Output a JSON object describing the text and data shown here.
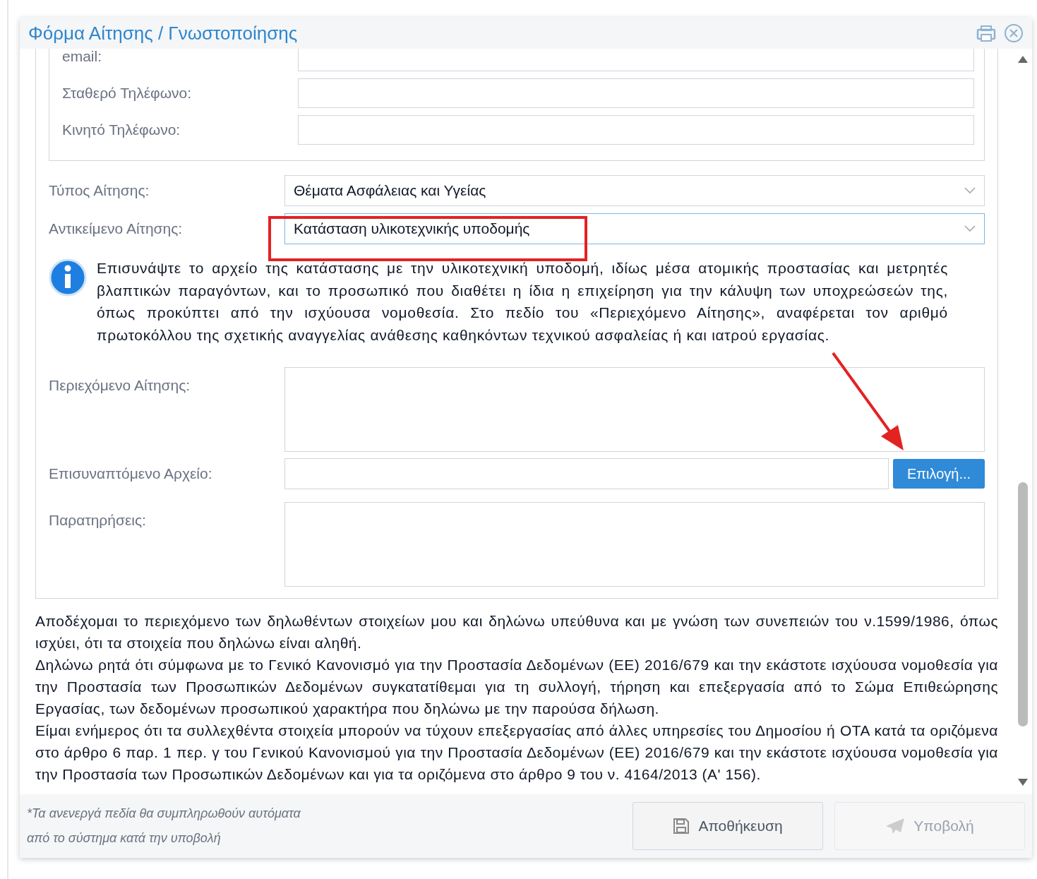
{
  "window": {
    "title": "Φόρμα Αίτησης / Γνωστοποίησης"
  },
  "contact_fields": [
    {
      "label": "email:"
    },
    {
      "label": "Σταθερό Τηλέφωνο:"
    },
    {
      "label": "Κινητό Τηλέφωνο:"
    }
  ],
  "selects": [
    {
      "label": "Τύπος Αίτησης:",
      "value": "Θέματα Ασφάλειας και Υγείας",
      "focused": false
    },
    {
      "label": "Αντικείμενο Αίτησης:",
      "value": "Κατάσταση υλικοτεχνικής υποδομής",
      "focused": true
    }
  ],
  "info": "Επισυνάψτε το αρχείο της κατάστασης με την υλικοτεχνική υποδομή, ιδίως μέσα ατομικής προστασίας και μετρητές βλαπτικών παραγόντων, και το προσωπικό που διαθέτει η ίδια η επιχείρηση για την κάλυψη των υποχρεώσεών της, όπως προκύπτει από την ισχύουσα νομοθεσία. Στο πεδίο του «Περιεχόμενο Αίτησης», αναφέρεται τον αριθμό πρωτοκόλλου της σχετικής αναγγελίας ανάθεσης καθηκόντων τεχνικού ασφαλείας ή και ιατρού εργασίας.",
  "content_field": {
    "label": "Περιεχόμενο Αίτησης:"
  },
  "attachment": {
    "label": "Επισυναπτόμενο Αρχείο:",
    "button": "Επιλογή..."
  },
  "remarks_field": {
    "label": "Παρατηρήσεις:"
  },
  "declaration": [
    "Αποδέχομαι το περιεχόμενο των δηλωθέντων στοιχείων μου και δηλώνω υπεύθυνα και με γνώση των συνεπειών του ν.1599/1986, όπως ισχύει, ότι τα στοιχεία που δηλώνω είναι αληθή.",
    "Δηλώνω ρητά ότι σύμφωνα με το Γενικό Κανονισμό για την Προστασία Δεδομένων (ΕΕ) 2016/679 και την εκάστοτε ισχύουσα νομοθεσία για την Προστασία των Προσωπικών Δεδομένων συγκατατίθεμαι για τη συλλογή, τήρηση και επεξεργασία από το Σώμα Επιθεώρησης Εργασίας, των δεδομένων προσωπικού χαρακτήρα που δηλώνω με την παρούσα δήλωση.",
    "Είμαι ενήμερος ότι τα συλλεχθέντα στοιχεία μπορούν να τύχουν επεξεργασίας από άλλες υπηρεσίες του Δημοσίου ή ΟΤΑ κατά τα οριζόμενα στο άρθρο 6 παρ. 1 περ. γ του Γενικού Κανονισμού για την Προστασία Δεδομένων (ΕΕ) 2016/679 και την εκάστοτε ισχύουσα νομοθεσία για την Προστασία των Προσωπικών Δεδομένων και για τα οριζόμενα στο άρθρο 9 του ν. 4164/2013 (Α' 156)."
  ],
  "footer": {
    "note": [
      "*Τα ανενεργά πεδία θα συμπληρωθούν αυτόματα",
      "από το σύστημα κατά την υποβολή"
    ],
    "buttons": [
      {
        "kind": "save",
        "label": "Αποθήκευση",
        "disabled": false
      },
      {
        "kind": "submit",
        "label": "Υποβολή",
        "disabled": true
      }
    ]
  }
}
